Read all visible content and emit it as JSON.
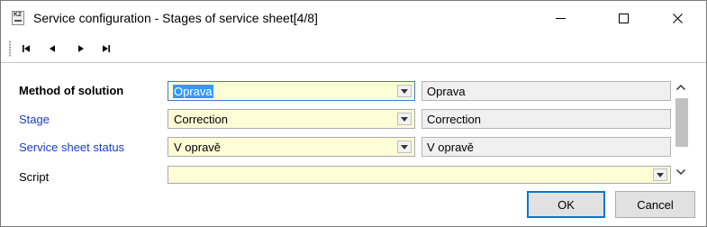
{
  "window": {
    "title": "Service configuration - Stages of service sheet[4/8]",
    "app_icon_text": "K2",
    "controls": [
      "minimize-icon",
      "maximize-icon",
      "close-icon"
    ]
  },
  "toolbar": {
    "buttons": [
      "first-record-icon",
      "previous-record-icon",
      "next-record-icon",
      "last-record-icon"
    ]
  },
  "form": {
    "rows": [
      {
        "label": "Method of solution",
        "value": "Oprava",
        "readonly_value": "Oprava"
      },
      {
        "label": "Stage",
        "value": "Correction",
        "readonly_value": "Correction"
      },
      {
        "label": "Service sheet status",
        "value": "V opravě",
        "readonly_value": "V opravě"
      },
      {
        "label": "Script",
        "value": ""
      }
    ]
  },
  "buttons": {
    "ok": "OK",
    "cancel": "Cancel"
  },
  "colors": {
    "combo_bg": "#fdfdd6",
    "link_label": "#1c3ec4",
    "selection": "#3399ff",
    "focus_border": "#0078d7"
  }
}
